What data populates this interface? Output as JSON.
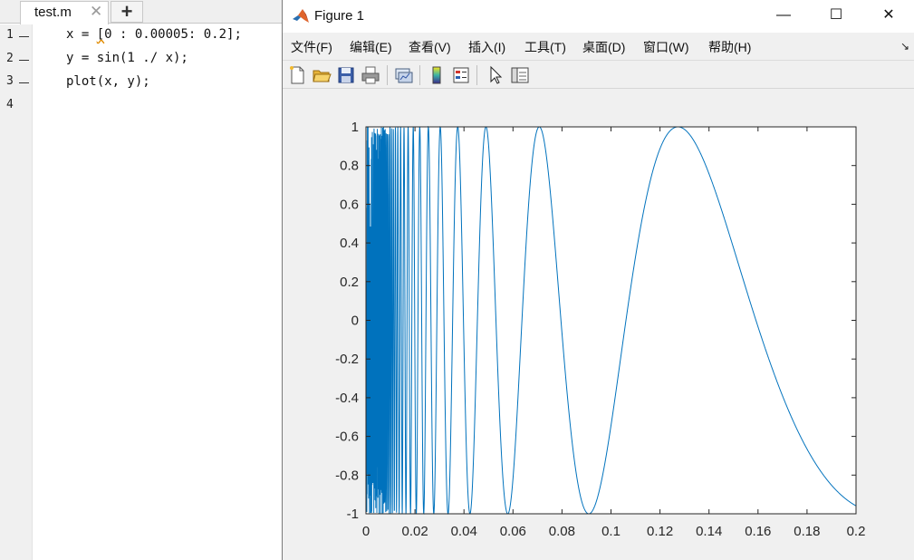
{
  "editor": {
    "tab": {
      "label": "test.m",
      "close_glyph": "✕",
      "add_glyph": "+"
    },
    "lines": [
      {
        "number": "1",
        "code_pre": "x = ",
        "code_bracket": "[",
        "code_post": "0 : 0.00005: 0.2];"
      },
      {
        "number": "2",
        "code": "y = sin(1 ./ x);"
      },
      {
        "number": "3",
        "code": "plot(x, y);"
      },
      {
        "number": "4",
        "code": ""
      }
    ]
  },
  "figure": {
    "title": "Figure 1",
    "window_buttons": {
      "minimize": "—",
      "maximize": "☐",
      "close": "✕"
    },
    "menus": [
      "文件(F)",
      "编辑(E)",
      "查看(V)",
      "插入(I)",
      "工具(T)",
      "桌面(D)",
      "窗口(W)",
      "帮助(H)"
    ],
    "menu_overflow": "↘",
    "toolbar_icons": [
      "new-figure-icon",
      "open-file-icon",
      "save-icon",
      "print-icon",
      "link-plot-icon",
      "insert-colorbar-icon",
      "insert-legend-icon",
      "pointer-icon",
      "plot-tools-icon"
    ]
  },
  "chart_data": {
    "type": "line",
    "function": "y = sin(1 ./ x)",
    "x_range": [
      0,
      0.2
    ],
    "x_step": 5e-05,
    "xlim": [
      0,
      0.2
    ],
    "ylim": [
      -1,
      1
    ],
    "xticks": [
      "0",
      "0.02",
      "0.04",
      "0.06",
      "0.08",
      "0.1",
      "0.12",
      "0.14",
      "0.16",
      "0.18",
      "0.2"
    ],
    "yticks": [
      "1",
      "0.8",
      "0.6",
      "0.4",
      "0.2",
      "0",
      "-0.2",
      "-0.4",
      "-0.6",
      "-0.8",
      "-1"
    ],
    "series": [
      {
        "color": "#0072BD"
      }
    ],
    "grid": false,
    "box": true
  }
}
